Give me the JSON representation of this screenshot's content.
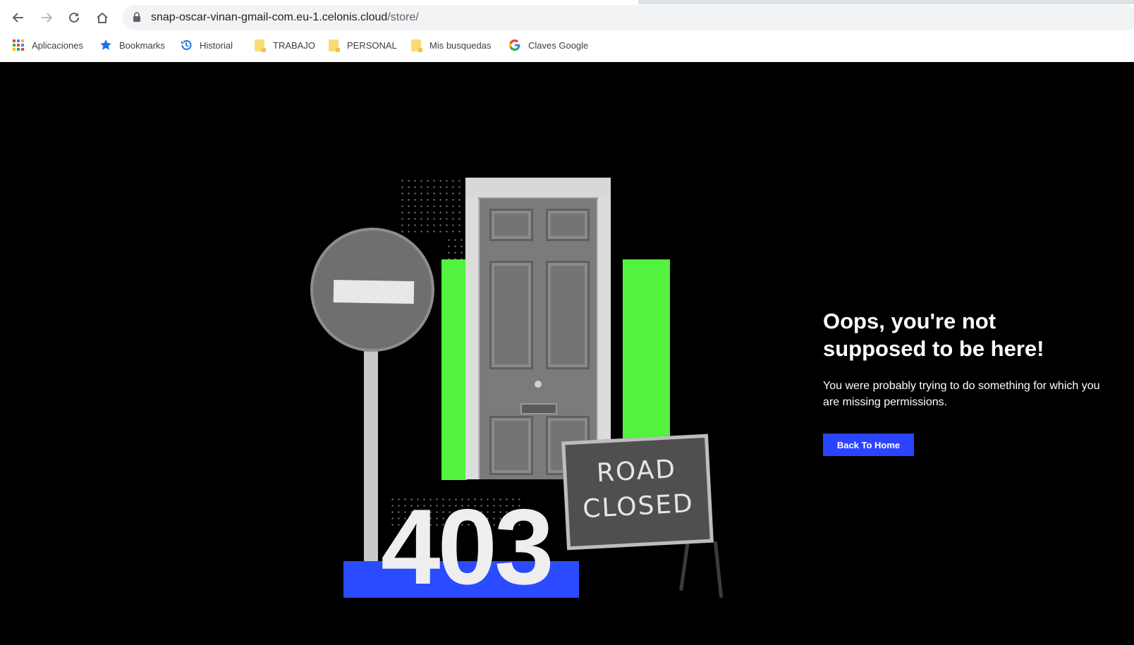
{
  "browser": {
    "url_host": "snap-oscar-vinan-gmail-com.eu-1.celonis.cloud",
    "url_path": "/store/",
    "nav_icons": [
      "back-arrow-icon",
      "forward-arrow-icon",
      "reload-icon",
      "home-icon",
      "lock-icon"
    ],
    "bookmarks": [
      {
        "label": "Aplicaciones",
        "icon": "apps-grid-icon"
      },
      {
        "label": "Bookmarks",
        "icon": "star-icon"
      },
      {
        "label": "Historial",
        "icon": "history-icon"
      },
      {
        "label": "TRABAJO",
        "icon": "folder-icon"
      },
      {
        "label": "PERSONAL",
        "icon": "folder-icon"
      },
      {
        "label": "Mis busquedas",
        "icon": "folder-icon"
      },
      {
        "label": "Claves Google",
        "icon": "google-g-icon"
      }
    ]
  },
  "illustration": {
    "code": "403",
    "road_sign_line1": "ROAD",
    "road_sign_line2": "CLOSED",
    "accent_green": "#52f23f",
    "accent_blue": "#2a4bff"
  },
  "message": {
    "title": "Oops, you're not supposed to be here!",
    "description": "You were probably trying to do something for which you are missing permissions.",
    "button_label": "Back To Home"
  },
  "colors": {
    "background": "#000000",
    "button_bg": "#2a44ff",
    "text": "#ffffff"
  }
}
